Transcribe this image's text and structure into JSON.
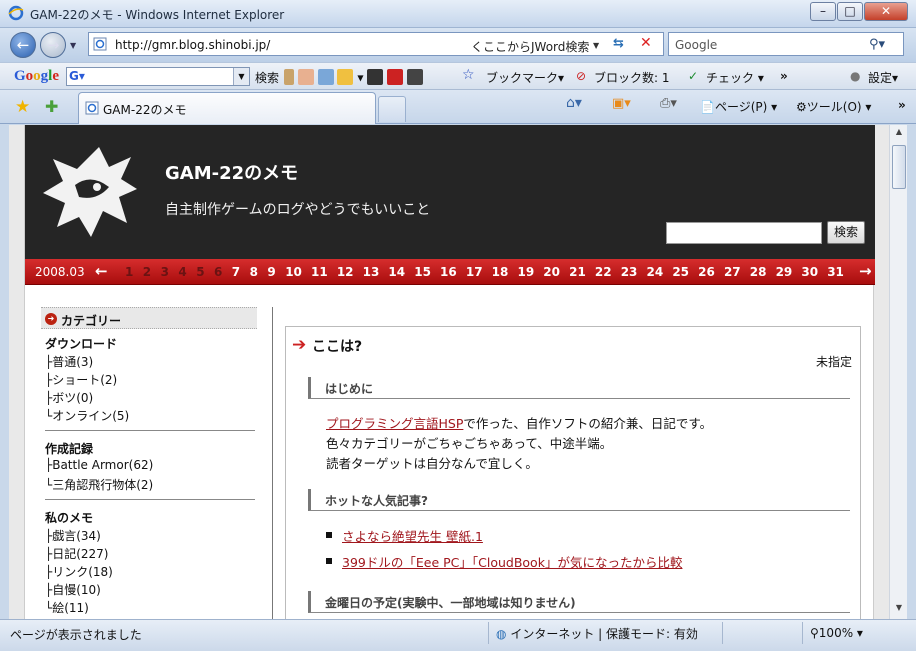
{
  "window": {
    "title": "GAM-22のメモ - Windows Internet Explorer"
  },
  "address_bar": {
    "url": "http://gmr.blog.shinobi.jp/",
    "jword_label": "くここからJWord検索",
    "search_placeholder": "Google"
  },
  "google_toolbar": {
    "logo": [
      "G",
      "o",
      "o",
      "g",
      "l",
      "e"
    ],
    "search_button": "検索",
    "bookmarks": "ブックマーク",
    "block_count": "ブロック数: 1",
    "check": "チェック",
    "more": "»",
    "settings": "設定"
  },
  "tabs": [
    {
      "label": "GAM-22のメモ"
    }
  ],
  "command_bar": {
    "page": "ページ(P)",
    "tools": "ツール(O)",
    "more": "»"
  },
  "blog": {
    "title": "GAM-22のメモ",
    "subtitle": "自主制作ゲームのログやどうでもいいこと",
    "search_button": "検索"
  },
  "calendar": {
    "month": "2008.03",
    "prev_arrow": "←",
    "next_arrow": "→",
    "days": [
      "1",
      "2",
      "3",
      "4",
      "5",
      "6",
      "7",
      "8",
      "9",
      "10",
      "11",
      "12",
      "13",
      "14",
      "15",
      "16",
      "17",
      "18",
      "19",
      "20",
      "21",
      "22",
      "23",
      "24",
      "25",
      "26",
      "27",
      "28",
      "29",
      "30",
      "31"
    ],
    "active_days": [
      "7",
      "8",
      "9",
      "10",
      "11",
      "12",
      "13",
      "14",
      "15",
      "16",
      "17",
      "18",
      "19",
      "20",
      "21",
      "22",
      "23",
      "24",
      "25",
      "26",
      "27",
      "28",
      "29",
      "30",
      "31"
    ]
  },
  "sidebar": {
    "header": "カテゴリー",
    "groups": [
      {
        "title": "ダウンロード",
        "items": [
          "├普通(3)",
          "├ショート(2)",
          "├ボツ(0)",
          "└オンライン(5)"
        ]
      },
      {
        "title": "作成記録",
        "items": [
          "├Battle Armor(62)",
          "└三角認飛行物体(2)"
        ]
      },
      {
        "title": "私のメモ",
        "items": [
          "├戯言(34)",
          "├日記(227)",
          "├リンク(18)",
          "├自慢(10)",
          "└絵(11)"
        ]
      }
    ]
  },
  "main": {
    "heading": "ここは?",
    "category": "未指定",
    "sections": [
      {
        "title": "はじめに"
      },
      {
        "title": "ホットな人気記事?"
      },
      {
        "title": "金曜日の予定(実験中、一部地域は知りません)"
      }
    ],
    "intro_link": "プログラミング言語HSP",
    "intro_line1_rest": "で作った、自作ソフトの紹介兼、日記です。",
    "intro_line2": "色々カテゴリーがごちゃごちゃあって、中途半端。",
    "intro_line3": "読者ターゲットは自分なんで宜しく。",
    "hot_articles": [
      "さよなら絶望先生 壁紙.1",
      "399ドルの「Eee PC」「CloudBook」が気になったから比較"
    ]
  },
  "status_bar": {
    "text": "ページが表示されました",
    "zone": "インターネット | 保護モード: 有効",
    "zoom": "100%"
  },
  "colors": {
    "header_bg": "#252525",
    "calendar_red": "#c41c1c",
    "link": "#a0161c"
  }
}
